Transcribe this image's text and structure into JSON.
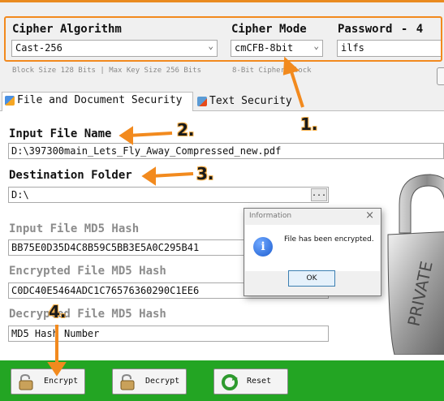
{
  "header": {
    "cipher_algorithm_label": "Cipher Algorithm",
    "cipher_mode_label": "Cipher Mode",
    "password_label": "Password - 4",
    "cipher_algorithm_value": "Cast-256",
    "cipher_mode_value": "cmCFB-8bit",
    "password_value": "ilfs",
    "algorithm_hint": "Block Size 128 Bits | Max Key Size 256 Bits",
    "mode_hint": "8-Bit Cipher Block"
  },
  "tabs": [
    {
      "label": "File and Document Security"
    },
    {
      "label": "Text Security"
    }
  ],
  "form": {
    "input_file_label": "Input File Name",
    "input_file_value": "D:\\397300main_Lets_Fly_Away_Compressed_new.pdf",
    "destination_label": "Destination Folder",
    "destination_value": "D:\\",
    "browse_label": "...",
    "input_md5_label": "Input File MD5 Hash",
    "input_md5_value": "BB75E0D35D4C8B59C5BB3E5A0C295B41",
    "encrypted_md5_label": "Encrypted File MD5 Hash",
    "encrypted_md5_value": "C0DC40E5464ADC1C76576360290C1EE6",
    "decrypted_md5_label": "Decrypted File MD5 Hash",
    "decrypted_md5_value": "MD5 Hash Number"
  },
  "lock_text": "PRIVATE",
  "dialog": {
    "title": "Information",
    "message": "File has been encrypted.",
    "ok_label": "OK"
  },
  "buttons": {
    "encrypt": "Encrypt",
    "decrypt": "Decrypt",
    "reset": "Reset"
  },
  "annotations": [
    "1.",
    "2.",
    "3.",
    "4."
  ],
  "colors": {
    "accent_orange": "#f28a1e",
    "bottom_bar_green": "#23a523"
  }
}
